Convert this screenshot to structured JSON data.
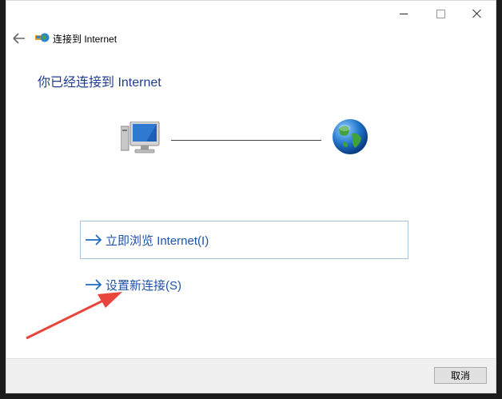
{
  "window": {
    "title": "连接到 Internet",
    "controls": [
      "minimize-icon",
      "maximize-icon",
      "close-icon"
    ]
  },
  "main": {
    "heading": "你已经连接到 Internet",
    "diagram": {
      "left_icon": "computer-monitor-icon",
      "right_icon": "globe-icon"
    },
    "options": [
      {
        "label": "立即浏览 Internet(I)",
        "icon": "arrow-right-icon"
      },
      {
        "label": "设置新连接(S)",
        "icon": "arrow-right-icon"
      }
    ]
  },
  "footer": {
    "cancel_label": "取消"
  },
  "colors": {
    "link": "#1f52a6",
    "heading": "#1e3c8c",
    "annotation_arrow": "#e8463c"
  }
}
